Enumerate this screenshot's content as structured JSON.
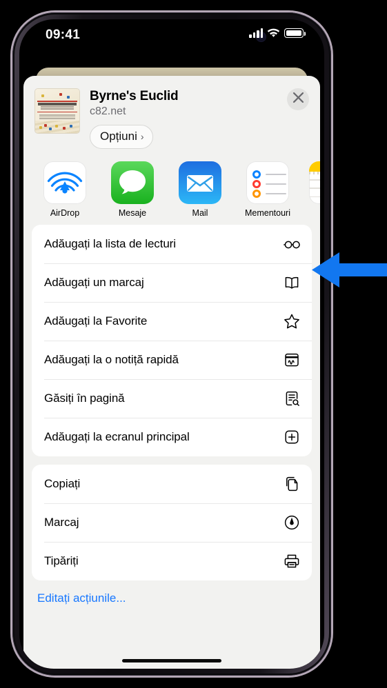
{
  "status_bar": {
    "time": "09:41",
    "signal_icon": "cellular-bars-icon",
    "wifi_icon": "wifi-icon",
    "battery_icon": "battery-full-icon"
  },
  "share_sheet": {
    "document": {
      "title": "Byrne's Euclid",
      "domain": "c82.net",
      "thumbnail_name": "book-cover-thumbnail"
    },
    "options_button": {
      "label": "Opțiuni",
      "chevron": "›"
    },
    "close_button_icon": "close-icon",
    "apps": [
      {
        "label": "AirDrop",
        "icon": "airdrop-icon"
      },
      {
        "label": "Mesaje",
        "icon": "messages-icon"
      },
      {
        "label": "Mail",
        "icon": "mail-icon"
      },
      {
        "label": "Mementouri",
        "icon": "reminders-icon"
      },
      {
        "label": "",
        "icon": "notes-icon"
      }
    ],
    "action_groups": [
      {
        "rows": [
          {
            "label": "Adăugați la lista de lecturi",
            "icon": "glasses-icon",
            "highlighted": true
          },
          {
            "label": "Adăugați un marcaj",
            "icon": "book-icon"
          },
          {
            "label": "Adăugați la Favorite",
            "icon": "star-icon"
          },
          {
            "label": "Adăugați la o notiță rapidă",
            "icon": "quick-note-icon"
          },
          {
            "label": "Găsiți în pagină",
            "icon": "find-in-page-icon"
          },
          {
            "label": "Adăugați la ecranul principal",
            "icon": "add-to-home-icon"
          }
        ]
      },
      {
        "rows": [
          {
            "label": "Copiați",
            "icon": "copy-icon"
          },
          {
            "label": "Marcaj",
            "icon": "markup-icon"
          },
          {
            "label": "Tipăriți",
            "icon": "print-icon"
          }
        ]
      }
    ],
    "edit_actions_label": "Editați acțiunile..."
  },
  "annotation": {
    "arrow_color": "#1277f0",
    "points_to": "Adăugați la lista de lecturi"
  },
  "colors": {
    "link_blue": "#1777ff",
    "sheet_bg": "#f2f2f0",
    "card_bg": "#ffffff"
  }
}
